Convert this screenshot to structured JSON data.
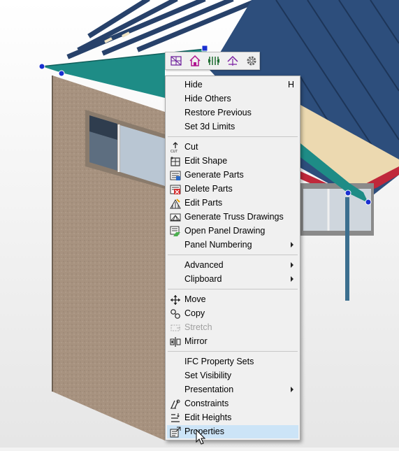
{
  "colors": {
    "roof_fascia": "#1e8c86",
    "roof_sheet": "#2c4d7a",
    "wall": "#a08c7c",
    "gutter": "#c0283a",
    "menu_bg": "#f0f0f0",
    "menu_highlight": "#cce4f7"
  },
  "toolbar": {
    "buttons": [
      {
        "icon": "truss-grid-icon"
      },
      {
        "icon": "house-roof-icon"
      },
      {
        "icon": "split-panel-icon"
      },
      {
        "icon": "roof-arrow-icon"
      },
      {
        "icon": "gear-icon"
      }
    ]
  },
  "menu": {
    "hide": "Hide",
    "hide_shortcut": "H",
    "hide_others": "Hide Others",
    "restore_previous": "Restore Previous",
    "set_3d_limits": "Set 3d Limits",
    "cut": "Cut",
    "edit_shape": "Edit Shape",
    "generate_parts": "Generate Parts",
    "delete_parts": "Delete Parts",
    "edit_parts": "Edit Parts",
    "generate_truss_drawings": "Generate Truss Drawings",
    "open_panel_drawing": "Open Panel Drawing",
    "panel_numbering": "Panel Numbering",
    "advanced": "Advanced",
    "clipboard": "Clipboard",
    "move": "Move",
    "copy": "Copy",
    "stretch": "Stretch",
    "mirror": "Mirror",
    "ifc_property_sets": "IFC Property Sets",
    "set_visibility": "Set Visibility",
    "presentation": "Presentation",
    "constraints": "Constraints",
    "edit_heights": "Edit Heights",
    "properties": "Properties"
  }
}
